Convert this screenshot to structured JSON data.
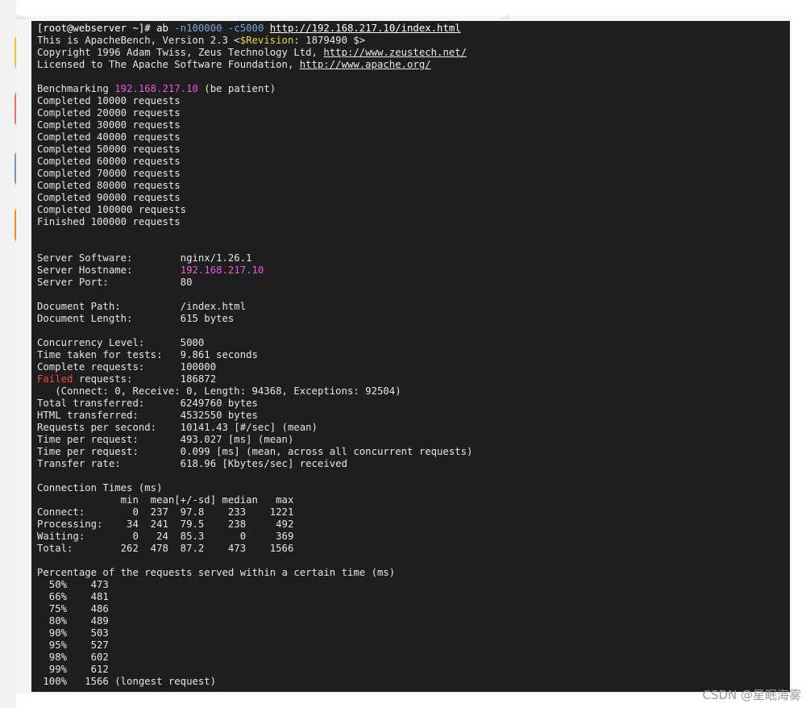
{
  "terminal": {
    "prompt": "[root@webserver ~]# ab ",
    "cmd_n": "-n100000",
    "cmd_c": "-c5000",
    "cmd_url": "http://192.168.217.10/index.html",
    "version_prefix": "This is ApacheBench, Version 2.3 <",
    "version_rev": "$Revision",
    "version_suffix": ": 1879490 $>",
    "copyright_text": "Copyright 1996 Adam Twiss, Zeus Technology Ltd, ",
    "copyright_url": "http://www.zeustech.net/",
    "license_text": "Licensed to The Apache Software Foundation, ",
    "license_url": "http://www.apache.org/",
    "bench_prefix": "Benchmarking ",
    "bench_host": "192.168.217.10",
    "bench_suffix": " (be patient)",
    "progress": [
      "Completed 10000 requests",
      "Completed 20000 requests",
      "Completed 30000 requests",
      "Completed 40000 requests",
      "Completed 50000 requests",
      "Completed 60000 requests",
      "Completed 70000 requests",
      "Completed 80000 requests",
      "Completed 90000 requests",
      "Completed 100000 requests",
      "Finished 100000 requests"
    ],
    "server_software": "Server Software:        nginx/1.26.1",
    "server_hostname_label": "Server Hostname:        ",
    "server_hostname_value": "192.168.217.10",
    "server_port": "Server Port:            80",
    "document_path": "Document Path:          /index.html",
    "document_length": "Document Length:        615 bytes",
    "concurrency": "Concurrency Level:      5000",
    "time_taken": "Time taken for tests:   9.861 seconds",
    "complete_requests": "Complete requests:      100000",
    "failed_word": "Failed",
    "failed_rest": " requests:        186872",
    "failed_detail": "   (Connect: 0, Receive: 0, Length: 94368, Exceptions: 92504)",
    "stats_after": [
      "Total transferred:      6249760 bytes",
      "HTML transferred:       4532550 bytes",
      "Requests per second:    10141.43 [#/sec] (mean)",
      "Time per request:       493.027 [ms] (mean)",
      "Time per request:       0.099 [ms] (mean, across all concurrent requests)",
      "Transfer rate:          618.96 [Kbytes/sec] received"
    ],
    "conn_times": [
      "Connection Times (ms)",
      "              min  mean[+/-sd] median   max",
      "Connect:        0  237  97.8    233    1221",
      "Processing:    34  241  79.5    238     492",
      "Waiting:        0   24  85.3      0     369",
      "Total:        262  478  87.2    473    1566"
    ],
    "percentiles": [
      "Percentage of the requests served within a certain time (ms)",
      "  50%    473",
      "  66%    481",
      "  75%    486",
      "  80%    489",
      "  90%    503",
      "  95%    527",
      "  98%    602",
      "  99%    612",
      " 100%   1566 (longest request)"
    ]
  },
  "watermark": "CSDN @星眠海雾"
}
